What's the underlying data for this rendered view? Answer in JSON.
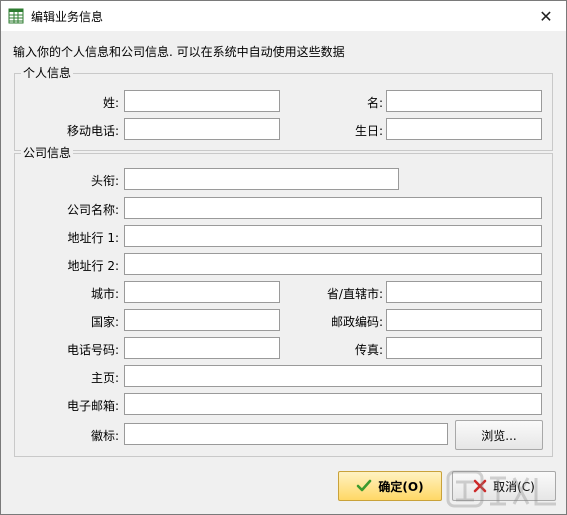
{
  "window": {
    "title": "编辑业务信息",
    "close_glyph": "✕"
  },
  "intro": "输入你的个人信息和公司信息. 可以在系统中自动使用这些数据",
  "personal": {
    "legend": "个人信息",
    "surname_label": "姓:",
    "given_name_label": "名:",
    "mobile_label": "移动电话:",
    "birthday_label": "生日:",
    "surname_value": "",
    "given_name_value": "",
    "mobile_value": "",
    "birthday_value": ""
  },
  "company": {
    "legend": "公司信息",
    "title_label": "头衔:",
    "company_label": "公司名称:",
    "address1_label": "地址行 1:",
    "address2_label": "地址行 2:",
    "city_label": "城市:",
    "province_label": "省/直辖市:",
    "country_label": "国家:",
    "postcode_label": "邮政编码:",
    "phone_label": "电话号码:",
    "fax_label": "传真:",
    "homepage_label": "主页:",
    "email_label": "电子邮箱:",
    "logo_label": "徽标:",
    "browse_label": "浏览...",
    "title_value": "",
    "company_value": "",
    "address1_value": "",
    "address2_value": "",
    "city_value": "",
    "province_value": "",
    "country_value": "",
    "postcode_value": "",
    "phone_value": "",
    "fax_value": "",
    "homepage_value": "",
    "email_value": "",
    "logo_value": ""
  },
  "buttons": {
    "ok_label": "确定(O)",
    "cancel_label": "取消(C)"
  },
  "colors": {
    "ok_accent": "#ffd866",
    "check_green": "#3c9a2e",
    "cancel_red": "#cc2b2b"
  }
}
